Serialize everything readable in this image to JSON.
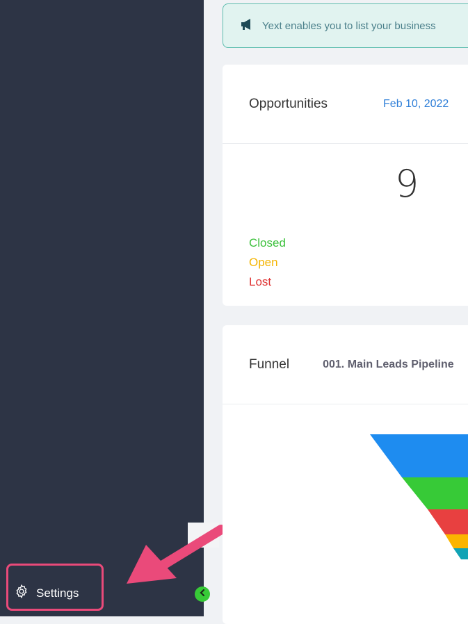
{
  "banner": {
    "icon": "megaphone-icon",
    "text": "Yext enables you to list your business"
  },
  "opportunities": {
    "title": "Opportunities",
    "date": "Feb 10, 2022",
    "count": "9",
    "legend": [
      {
        "label": "Closed",
        "color": "#3cc13c"
      },
      {
        "label": "Open",
        "color": "#f4b400"
      },
      {
        "label": "Lost",
        "color": "#e03535"
      }
    ]
  },
  "funnel": {
    "title": "Funnel",
    "pipeline": "001. Main Leads Pipeline",
    "stage_colors": [
      "#1e8cf0",
      "#37ca37",
      "#e84040",
      "#fbb400",
      "#11a3b5"
    ]
  },
  "sidebar": {
    "settings_label": "Settings",
    "collapse_icon": "chevron-left-icon",
    "settings_icon": "gear-icon"
  },
  "annotation": {
    "arrow_color": "#ea4a7a"
  }
}
